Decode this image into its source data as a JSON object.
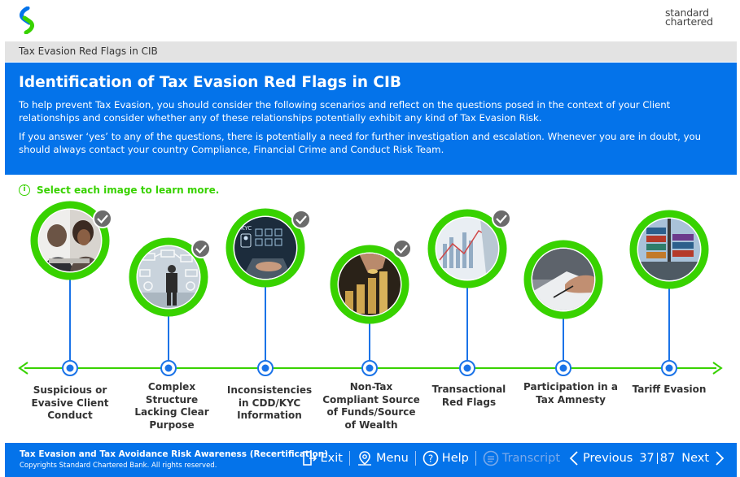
{
  "header": {
    "brand_line1": "standard",
    "brand_line2": "chartered"
  },
  "breadcrumb": "Tax Evasion Red Flags in CIB",
  "banner": {
    "title": "Identification of Tax Evasion Red Flags in CIB",
    "para1": "To help prevent Tax Evasion, you should consider the following scenarios and reflect on the questions posed in the context of your Client relationships and consider whether any of these relationships potentially exhibit any kind of Tax Evasion Risk.",
    "para2": "If you answer ‘yes’ to any of the questions, there is potentially a need for further investigation and escalation. Whenever you are in doubt, you should always contact your country Compliance, Financial Crime and Conduct Risk Team."
  },
  "hint": "Select each image to learn more.",
  "colors": {
    "brand_blue": "#0473ea",
    "accent_green": "#38d200",
    "node_blue": "#1a73e8"
  },
  "scenarios": [
    {
      "label": "Suspicious or Evasive Client Conduct",
      "visited": true,
      "image_icon": "business-meeting-photo"
    },
    {
      "label": "Complex Structure Lacking Clear Purpose",
      "visited": true,
      "image_icon": "complex-structure-photo"
    },
    {
      "label": "Inconsistencies in CDD/KYC Information",
      "visited": true,
      "image_icon": "kyc-laptop-photo"
    },
    {
      "label": "Non-Tax Compliant Source of Funds/Source of Wealth",
      "visited": true,
      "image_icon": "coins-photo"
    },
    {
      "label": "Transactional Red Flags",
      "visited": true,
      "image_icon": "financial-charts-photo"
    },
    {
      "label": "Participation in a Tax Amnesty",
      "visited": false,
      "image_icon": "document-signing-photo"
    },
    {
      "label": "Tariff Evasion",
      "visited": false,
      "image_icon": "shipping-containers-photo"
    }
  ],
  "footer": {
    "course_title": "Tax Evasion and Tax Avoidance Risk Awareness (Recertification)",
    "copyright": "Copyrights Standard Chartered Bank. All rights reserved.",
    "exit": "Exit",
    "menu": "Menu",
    "help": "Help",
    "transcript": "Transcript",
    "previous": "Previous",
    "page_current": "37",
    "page_total": "87",
    "next": "Next"
  }
}
